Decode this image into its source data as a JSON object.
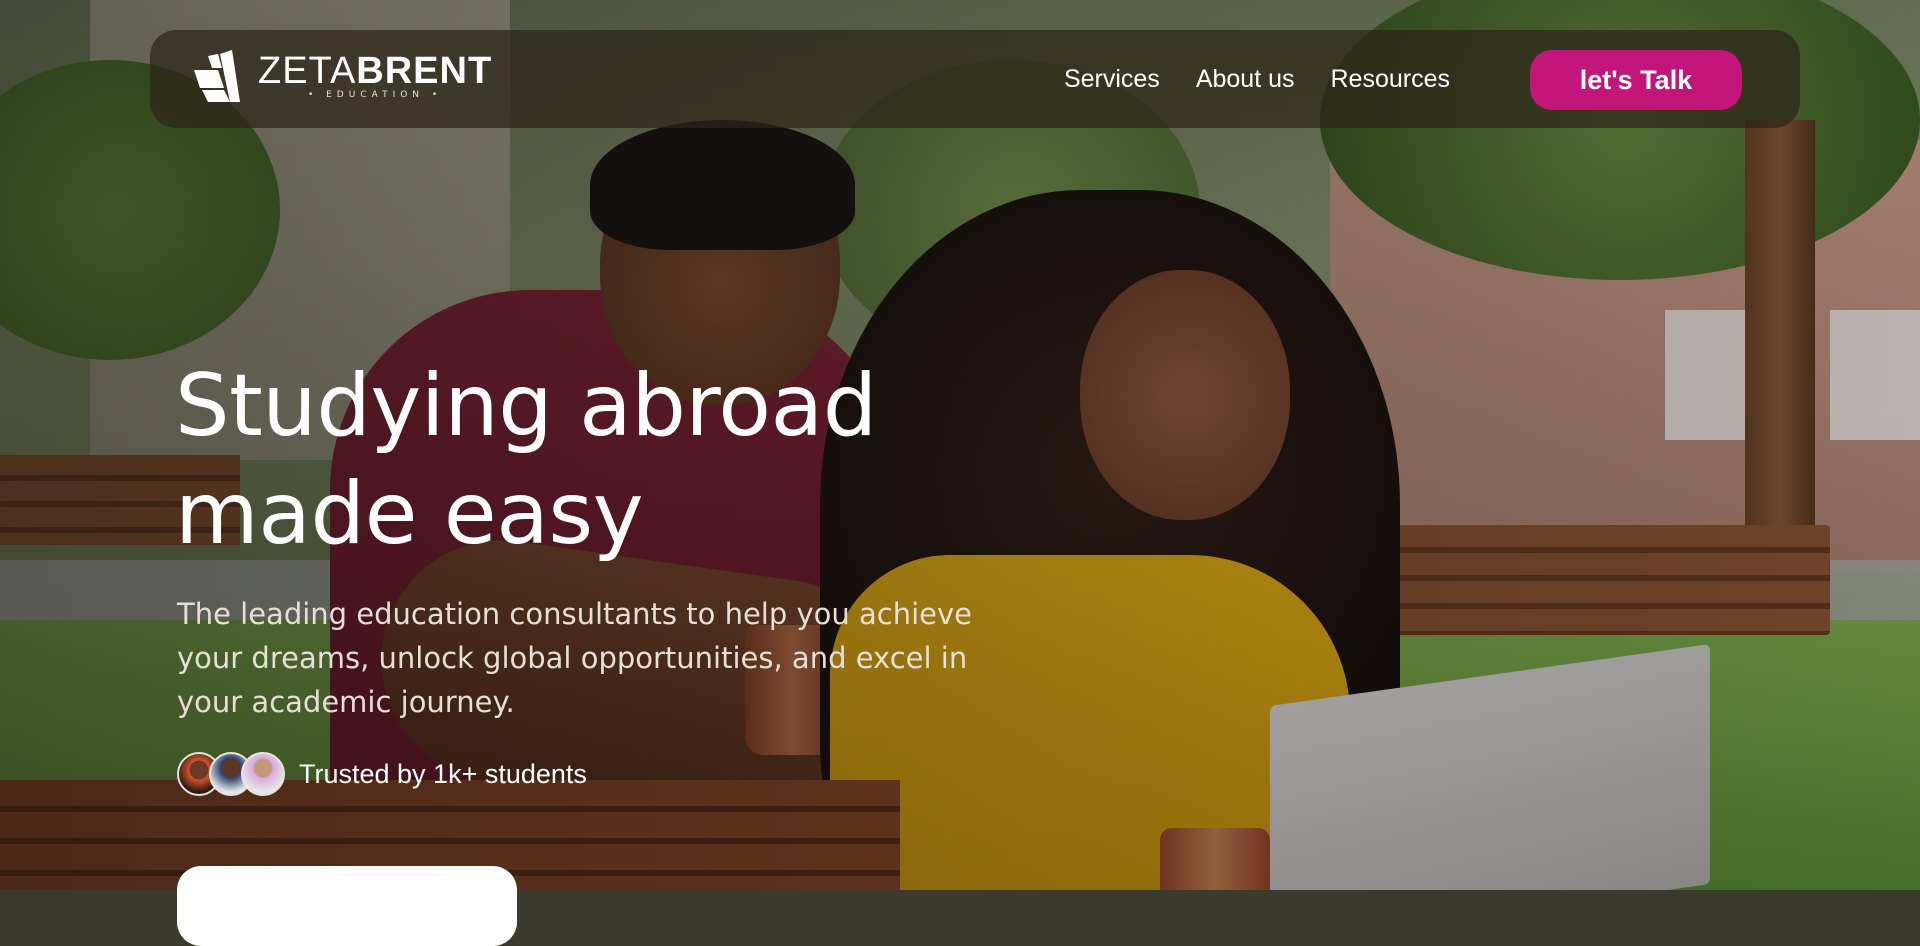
{
  "brand": {
    "name_part1": "ZETA",
    "name_part2": "BRENT",
    "tagline": "• EDUCATION •"
  },
  "nav": {
    "links": [
      {
        "label": "Services"
      },
      {
        "label": "About us"
      },
      {
        "label": "Resources"
      }
    ],
    "cta_label": "let's Talk"
  },
  "hero": {
    "title_line1": "Studying abroad",
    "title_line2": "made easy",
    "subtitle": "The leading education consultants to help you achieve your dreams, unlock global opportunities, and excel in your academic journey.",
    "trusted_text": "Trusted by 1k+ students"
  },
  "colors": {
    "accent": "#c2157a",
    "nav_background": "rgba(45,36,24,0.72)",
    "text": "#ffffff"
  }
}
